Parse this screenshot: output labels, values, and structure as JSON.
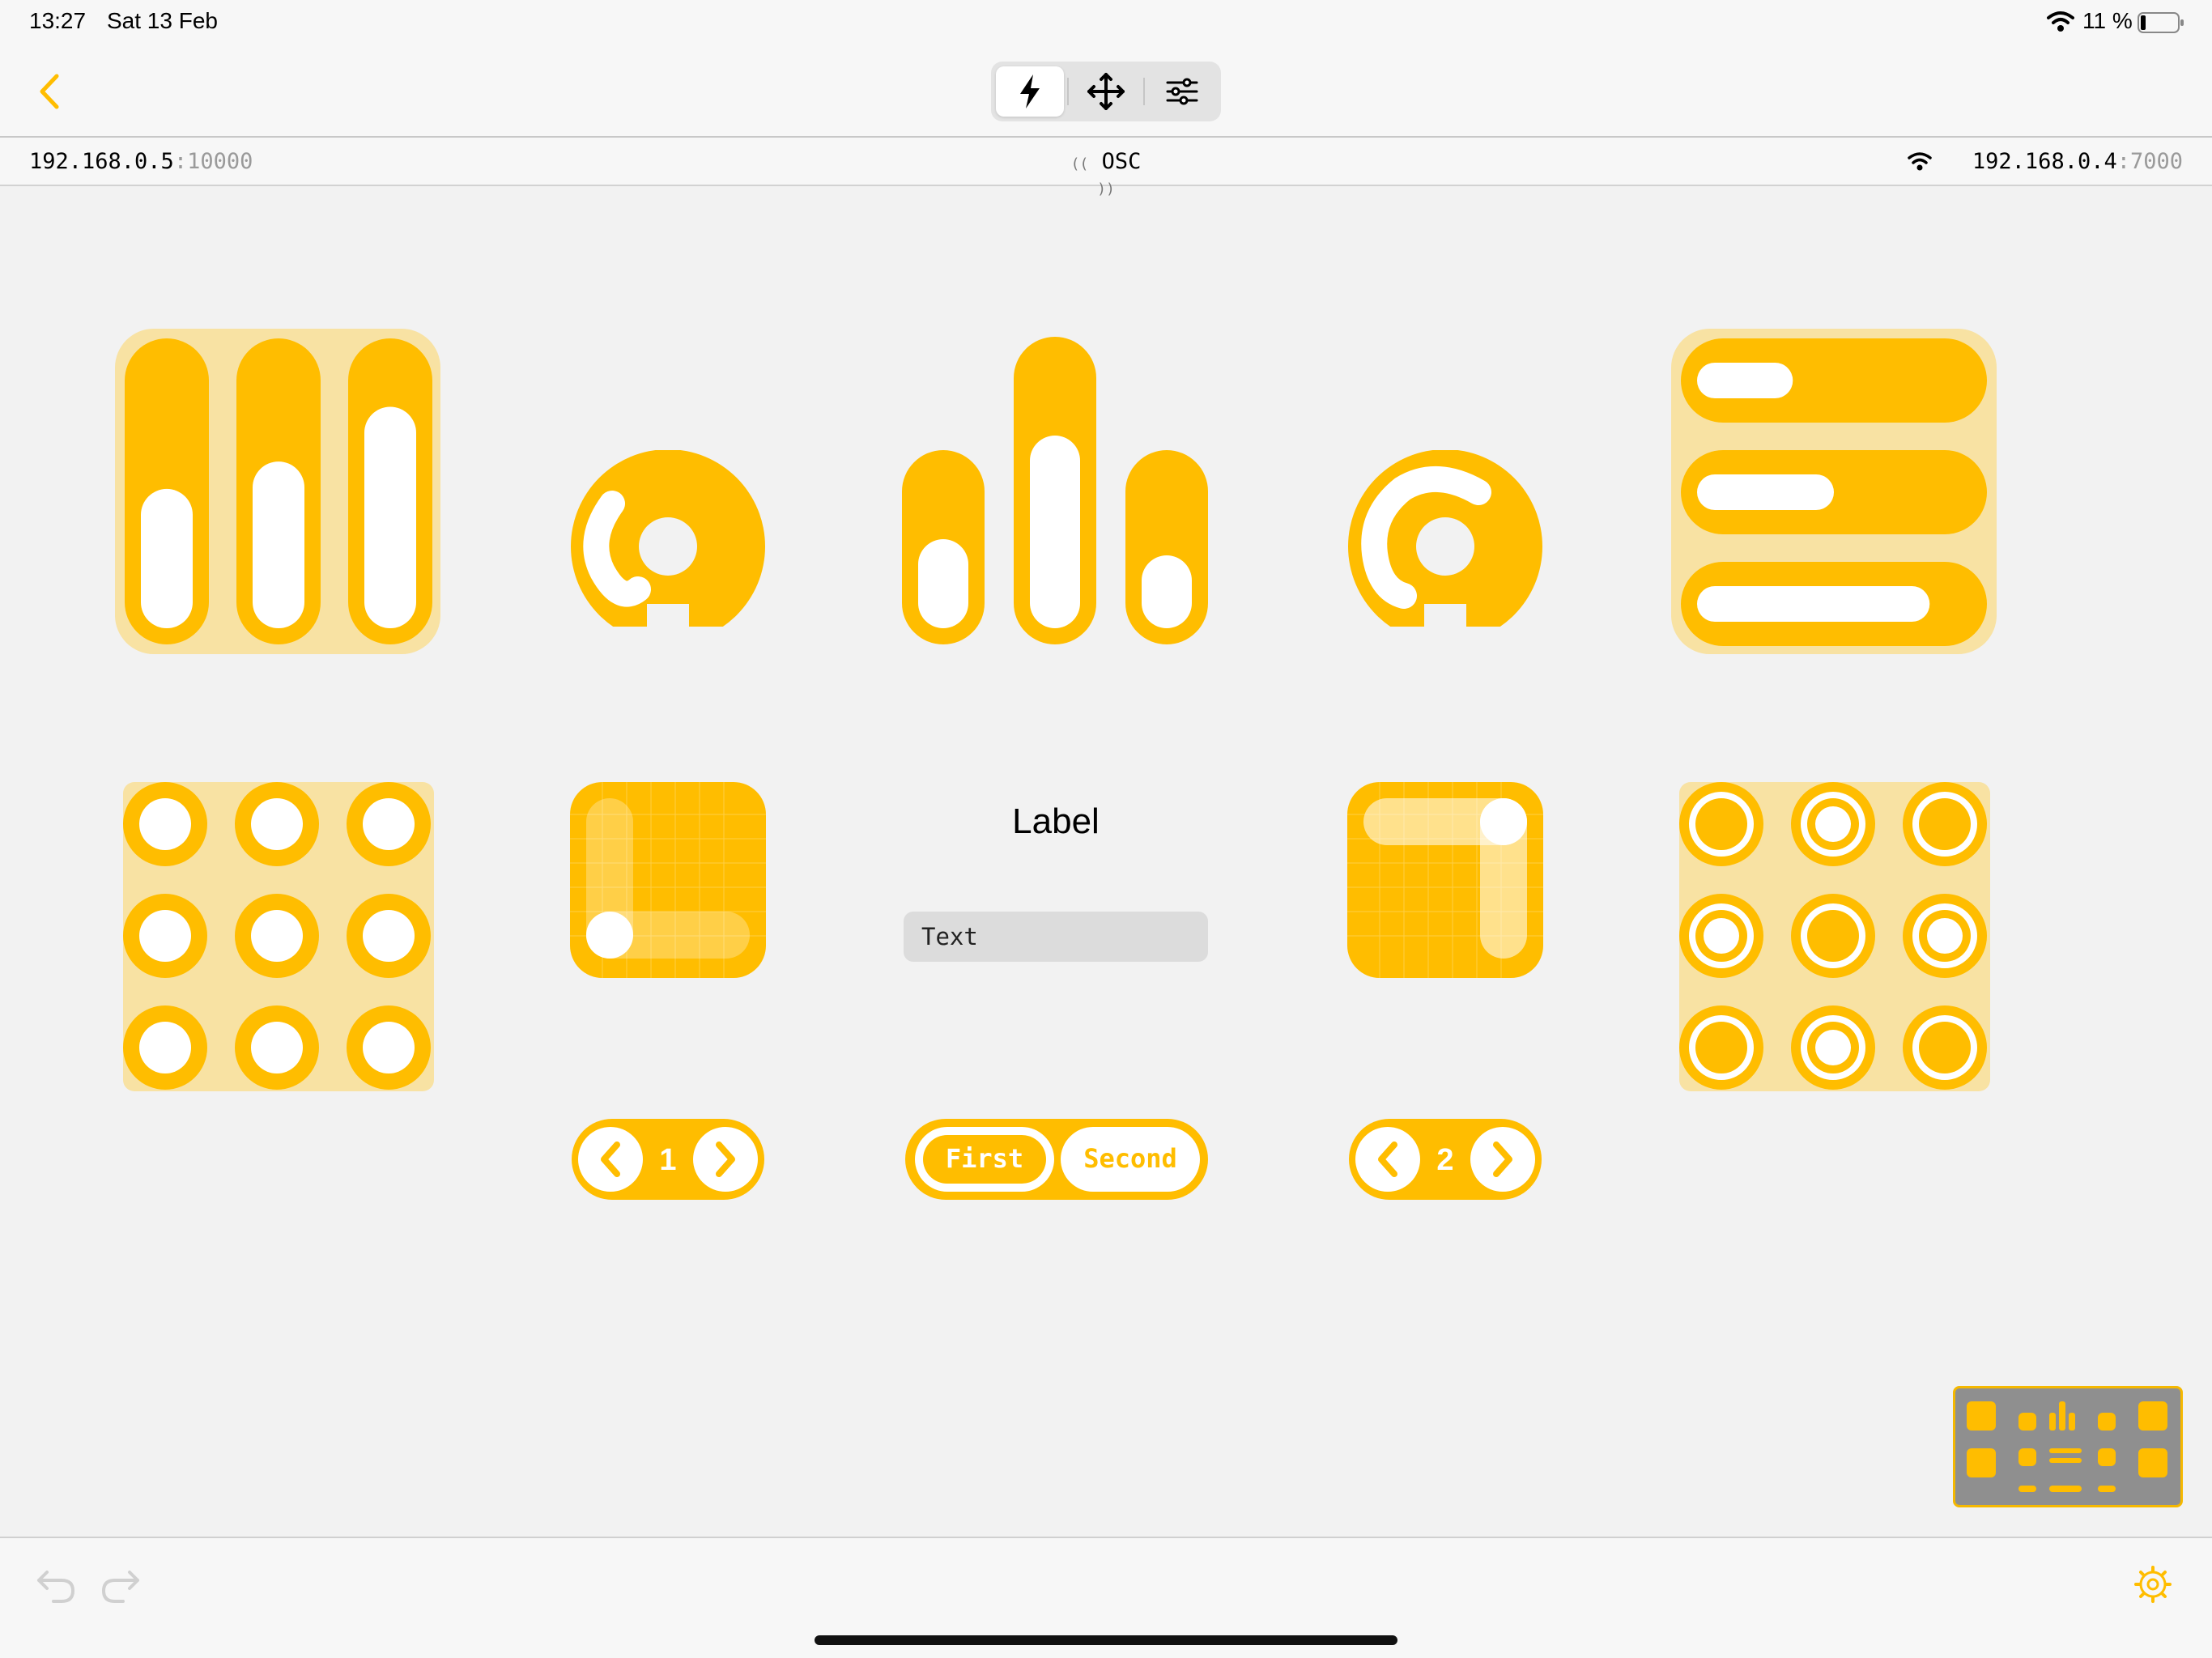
{
  "status_bar": {
    "time": "13:27",
    "date": "Sat 13 Feb",
    "battery_percent": "11 %"
  },
  "nav": {
    "back_icon": "chevron-left-icon",
    "modes": [
      {
        "icon": "bolt-icon",
        "name": "perform",
        "selected": true
      },
      {
        "icon": "move-arrows-icon",
        "name": "move",
        "selected": false
      },
      {
        "icon": "sliders-icon",
        "name": "settings",
        "selected": false
      }
    ]
  },
  "connection": {
    "local_ip": "192.168.0.5",
    "local_port": ":10000",
    "protocol": "OSC",
    "remote_ip": "192.168.0.4",
    "remote_port": ":7000"
  },
  "widgets": {
    "faders_vertical": {
      "levels": [
        0.45,
        0.55,
        0.75
      ]
    },
    "bars_vertical": {
      "levels": [
        0.55,
        0.7,
        0.45
      ]
    },
    "faders_horizontal": {
      "levels": [
        0.35,
        0.5,
        0.85
      ]
    },
    "xy_pad_left": {
      "x": 0.0,
      "y": 0.0
    },
    "label": "Label",
    "text_field": "Text",
    "xy_pad_right": {
      "x": 1.0,
      "y": 1.0
    },
    "stepper_left": {
      "value": "1"
    },
    "segmented": {
      "options": [
        "First",
        "Second"
      ],
      "selected": "First"
    },
    "stepper_right": {
      "value": "2"
    }
  },
  "bottom_bar": {
    "undo_icon": "undo-icon",
    "redo_icon": "redo-icon",
    "settings_icon": "gear-icon"
  },
  "colors": {
    "accent": "#ffbd00",
    "accent_light": "#f8e2a3",
    "background": "#f2f2f2"
  }
}
